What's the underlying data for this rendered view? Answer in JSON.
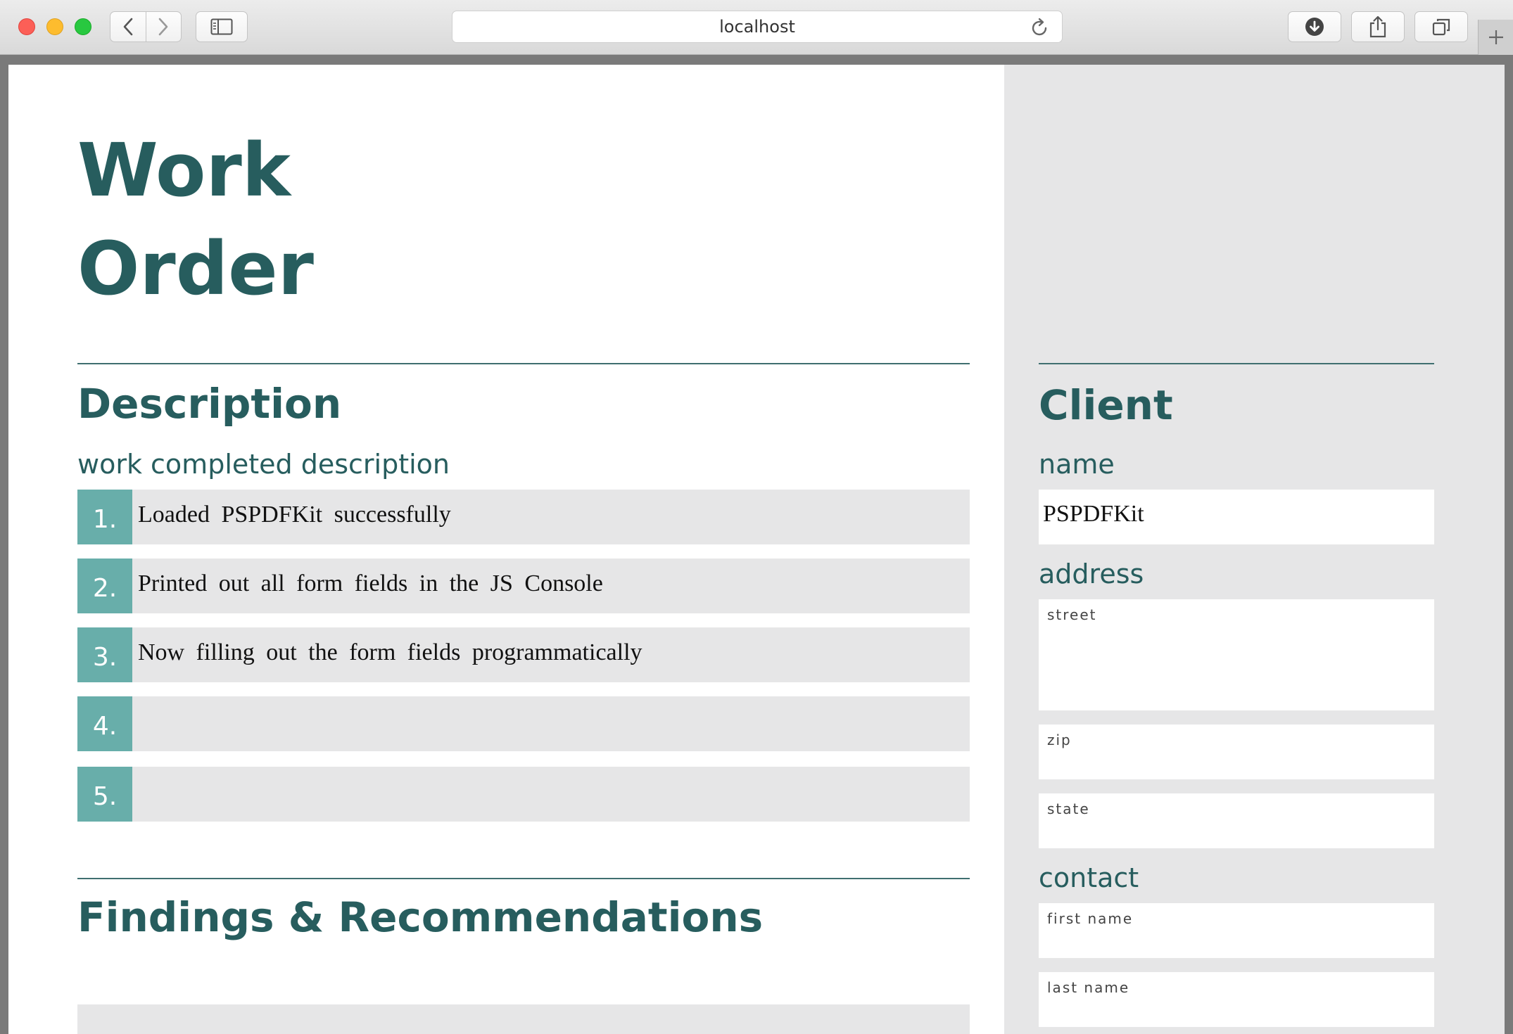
{
  "browser": {
    "url": "localhost"
  },
  "page": {
    "title_line1": "Work",
    "title_line2": "Order",
    "description": {
      "heading": "Description",
      "subheading": "work completed description",
      "rows": [
        {
          "num": "1.",
          "text": "Loaded PSPDFKit successfully"
        },
        {
          "num": "2.",
          "text": "Printed out all form fields in the JS Console"
        },
        {
          "num": "3.",
          "text": "Now filling out the form fields programmatically"
        },
        {
          "num": "4.",
          "text": ""
        },
        {
          "num": "5.",
          "text": ""
        }
      ]
    },
    "findings": {
      "heading": "Findings & Recommendations"
    },
    "client": {
      "heading": "Client",
      "name_label": "name",
      "name_value": "PSPDFKit",
      "address_label": "address",
      "street_label": "street",
      "zip_label": "zip",
      "state_label": "state",
      "contact_label": "contact",
      "first_name_label": "first name",
      "last_name_label": "last name"
    }
  },
  "colors": {
    "accent": "#275d5e",
    "number_box": "#68aeaa",
    "field_bg": "#e6e6e7"
  }
}
